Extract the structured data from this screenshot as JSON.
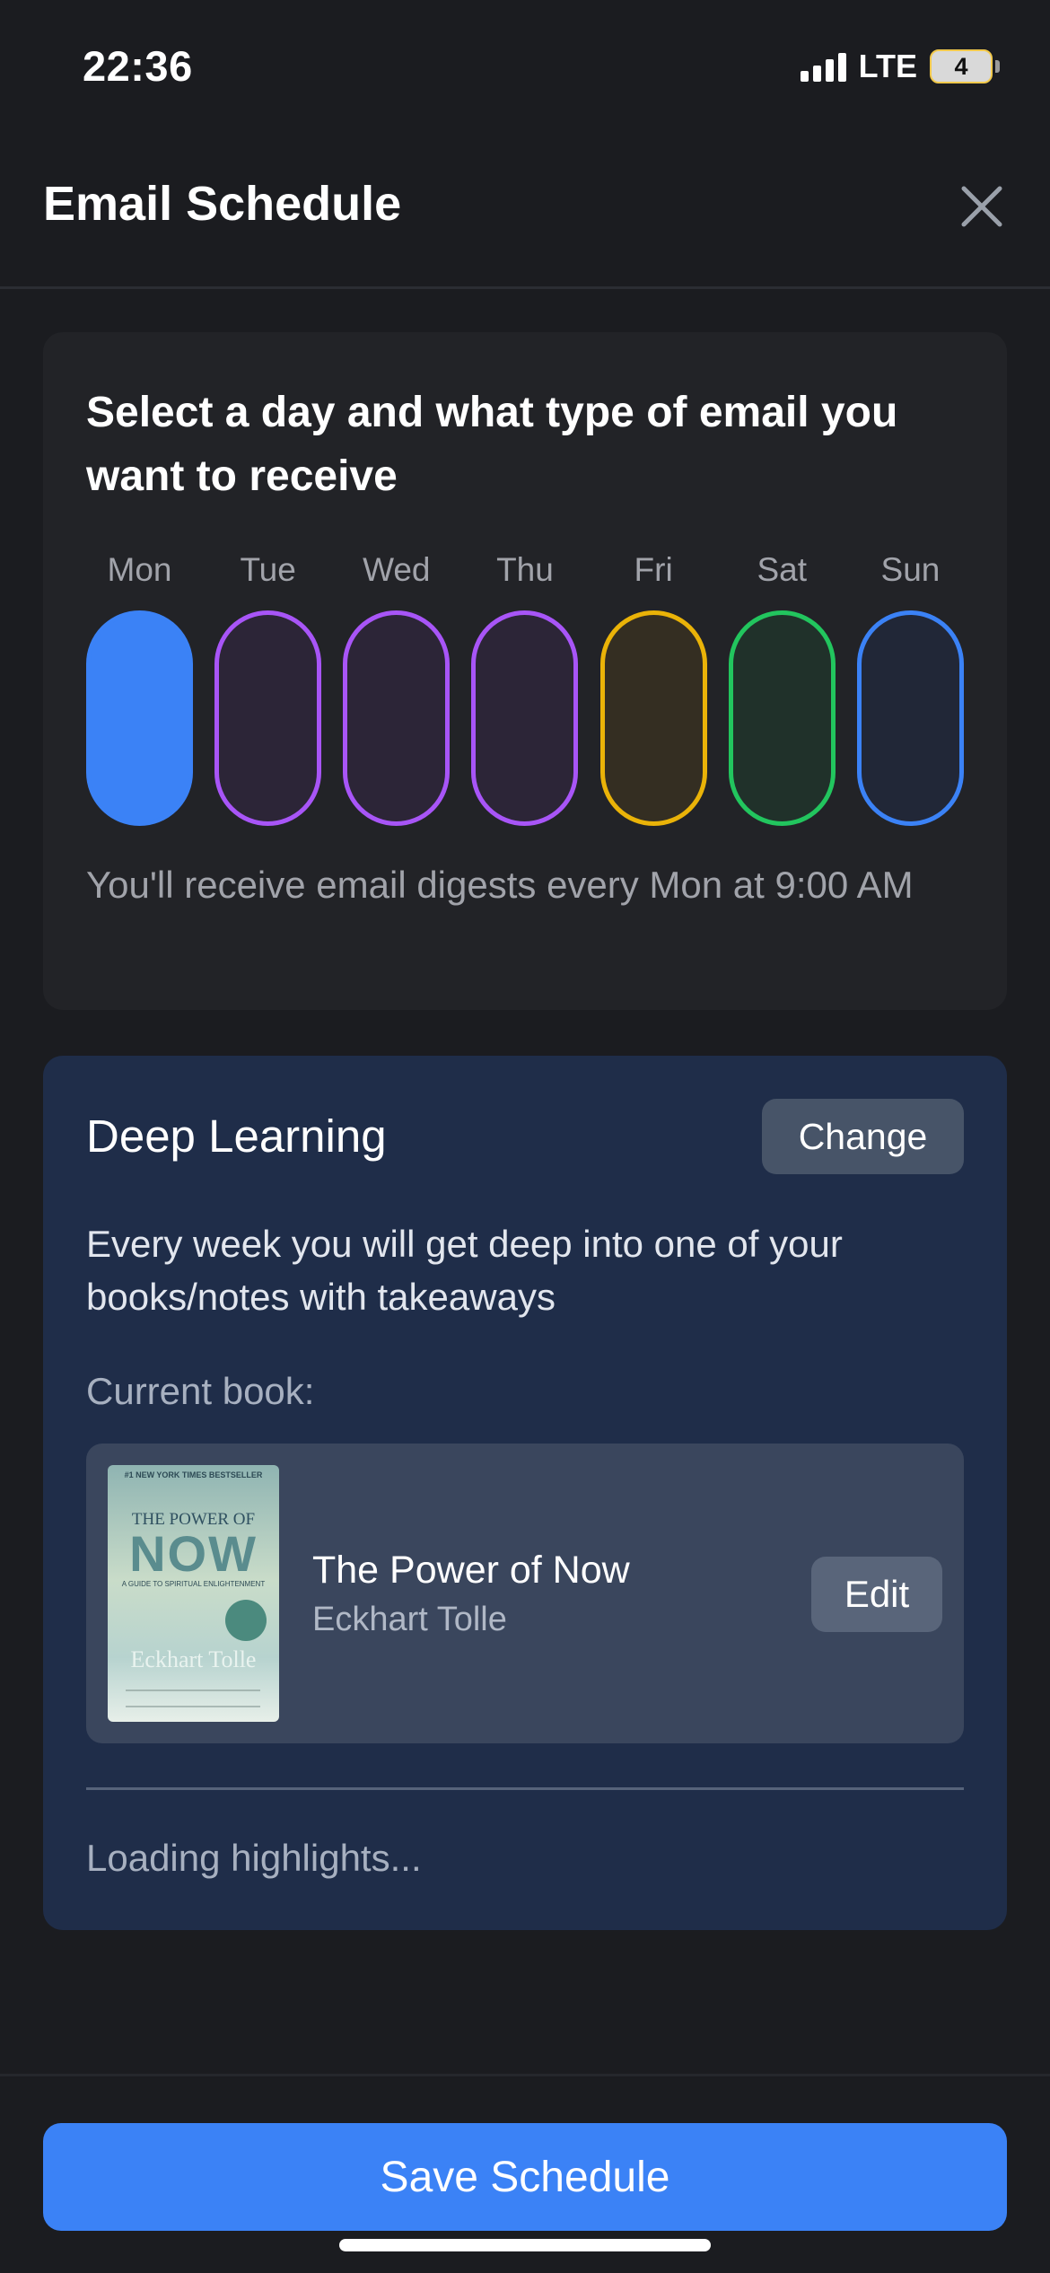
{
  "status_bar": {
    "time": "22:36",
    "network": "LTE",
    "battery": "4"
  },
  "header": {
    "title": "Email Schedule",
    "close_icon": "close-icon"
  },
  "schedule": {
    "heading": "Select a day and what type of email you want to receive",
    "days": [
      {
        "label": "Mon",
        "state": "selected",
        "color": "#3b82f6"
      },
      {
        "label": "Tue",
        "state": "outline",
        "color": "#a855f7"
      },
      {
        "label": "Wed",
        "state": "outline",
        "color": "#a855f7"
      },
      {
        "label": "Thu",
        "state": "outline",
        "color": "#a855f7"
      },
      {
        "label": "Fri",
        "state": "outline",
        "color": "#eab308"
      },
      {
        "label": "Sat",
        "state": "outline",
        "color": "#22c55e"
      },
      {
        "label": "Sun",
        "state": "outline",
        "color": "#3b82f6"
      }
    ],
    "note": "You'll receive email digests every Mon at 9:00 AM"
  },
  "learning": {
    "title": "Deep Learning",
    "change_label": "Change",
    "description": "Every week you will get deep into one of your books/notes with takeaways",
    "current_label": "Current book:",
    "book": {
      "title": "The Power of Now",
      "author": "Eckhart Tolle",
      "cover": {
        "top_line": "#1 NEW YORK TIMES BESTSELLER",
        "the": "THE POWER OF",
        "now": "NOW",
        "subtitle": "A GUIDE TO SPIRITUAL ENLIGHTENMENT",
        "author": "Eckhart Tolle"
      }
    },
    "edit_label": "Edit",
    "loading": "Loading highlights..."
  },
  "footer": {
    "save_label": "Save Schedule"
  },
  "colors": {
    "background": "#1b1c20",
    "accent": "#3b82f6",
    "learning_card": "#1f2d49"
  }
}
